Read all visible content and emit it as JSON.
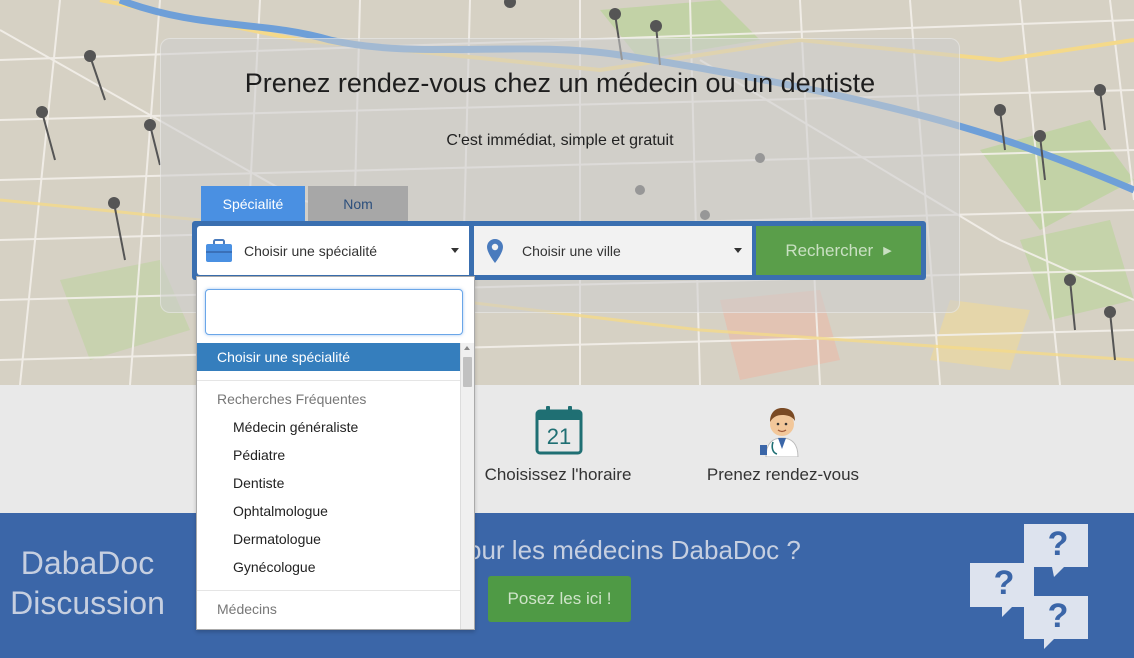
{
  "hero": {
    "title": "Prenez rendez-vous chez un médecin ou un dentiste",
    "subtitle": "C'est immédiat, simple et gratuit"
  },
  "tabs": [
    {
      "label": "Spécialité",
      "active": true
    },
    {
      "label": "Nom",
      "active": false
    }
  ],
  "search": {
    "specialite_placeholder": "Choisir une spécialité",
    "ville_placeholder": "Choisir une ville",
    "button_label": "Rechercher",
    "button_arrow": "▶"
  },
  "dropdown": {
    "search_value": "",
    "highlighted": "Choisir une spécialité",
    "groups": [
      {
        "label": "Recherches Fréquentes",
        "items": [
          "Médecin généraliste",
          "Pédiatre",
          "Dentiste",
          "Ophtalmologue",
          "Dermatologue",
          "Gynécologue"
        ]
      },
      {
        "label": "Médecins",
        "items": []
      }
    ]
  },
  "steps": [
    {
      "label": "Choisissez l'horaire",
      "icon": "calendar-icon",
      "calendar_day": "21"
    },
    {
      "label": "Prenez rendez-vous",
      "icon": "doctor-icon"
    }
  ],
  "discussion": {
    "title_line1": "DabaDoc",
    "title_line2": "Discussion",
    "question": "our les médecins DabaDoc ?",
    "button_label": "Posez les ici !",
    "bubble_mark": "?"
  },
  "colors": {
    "primary_blue": "#3a6fb0",
    "tab_active": "#4a90e2",
    "search_green": "#5a9e4a",
    "band_blue": "#3b66a8",
    "highlight_blue": "#357ebd",
    "teal_icon": "#1f6f73"
  }
}
